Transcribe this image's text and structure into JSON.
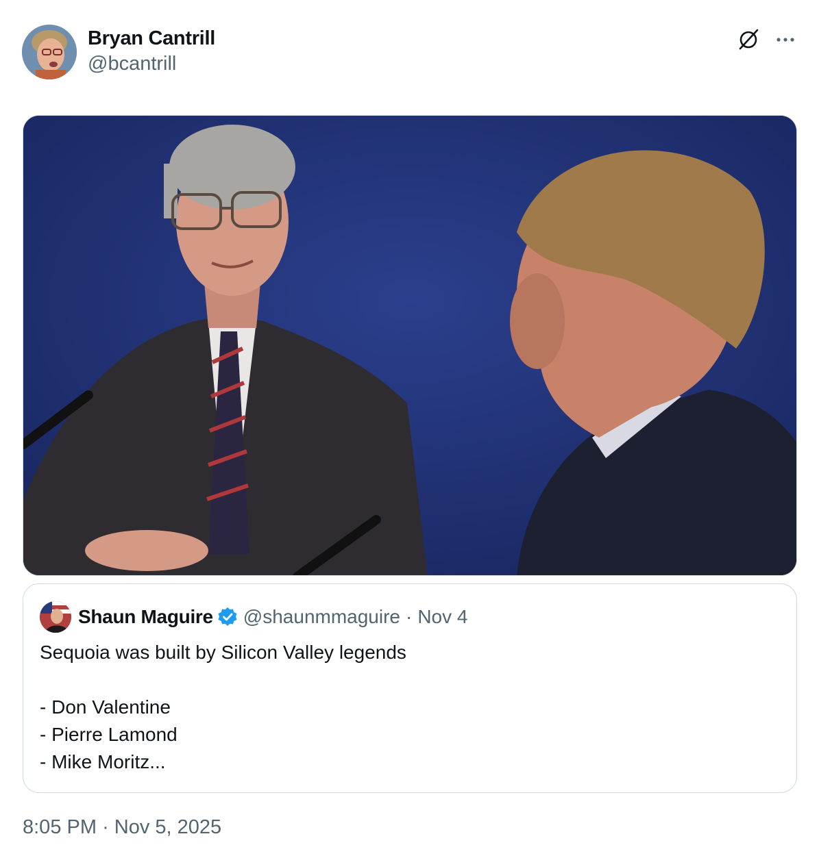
{
  "tweet": {
    "author_name": "Bryan Cantrill",
    "author_handle": "@bcantrill",
    "timestamp": "8:05 PM",
    "date": "Nov 5, 2025",
    "separator": "·"
  },
  "quoted": {
    "author_name": "Shaun Maguire",
    "author_handle": "@shaunmmaguire",
    "separator": "·",
    "date": "Nov 4",
    "text": "Sequoia was built by Silicon Valley legends\n\n- Don Valentine\n- Pierre Lamond\n- Mike Moritz..."
  },
  "icons": {
    "grok": "grok-icon",
    "more": "more-dots-icon",
    "verified": "verified-badge-icon"
  },
  "colors": {
    "text_primary": "#0f1419",
    "text_secondary": "#536471",
    "border": "#cfd9de",
    "verified_blue": "#1d9bf0",
    "media_background": "#1f2f6e"
  }
}
